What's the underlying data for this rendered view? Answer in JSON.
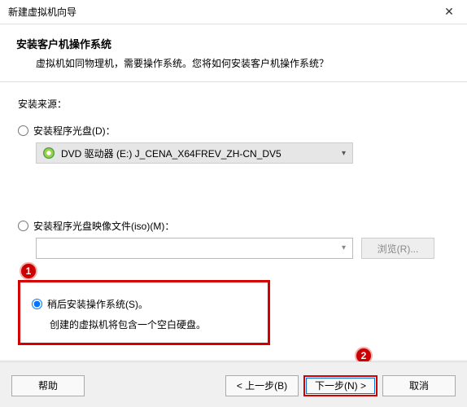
{
  "titlebar": {
    "title": "新建虚拟机向导"
  },
  "header": {
    "heading": "安装客户机操作系统",
    "subtext": "虚拟机如同物理机，需要操作系统。您将如何安装客户机操作系统？"
  },
  "source_label": "安装来源：",
  "options": {
    "disc": {
      "label": "安装程序光盘(D)：",
      "drive_text": "DVD 驱动器 (E:) J_CENA_X64FREV_ZH-CN_DV5"
    },
    "iso": {
      "label": "安装程序光盘映像文件(iso)(M)：",
      "browse": "浏览(R)..."
    },
    "later": {
      "label": "稍后安装操作系统(S)。",
      "desc": "创建的虚拟机将包含一个空白硬盘。"
    }
  },
  "markers": {
    "m1": "1",
    "m2": "2"
  },
  "footer": {
    "help": "帮助",
    "back": "< 上一步(B)",
    "next": "下一步(N) >",
    "cancel": "取消"
  }
}
